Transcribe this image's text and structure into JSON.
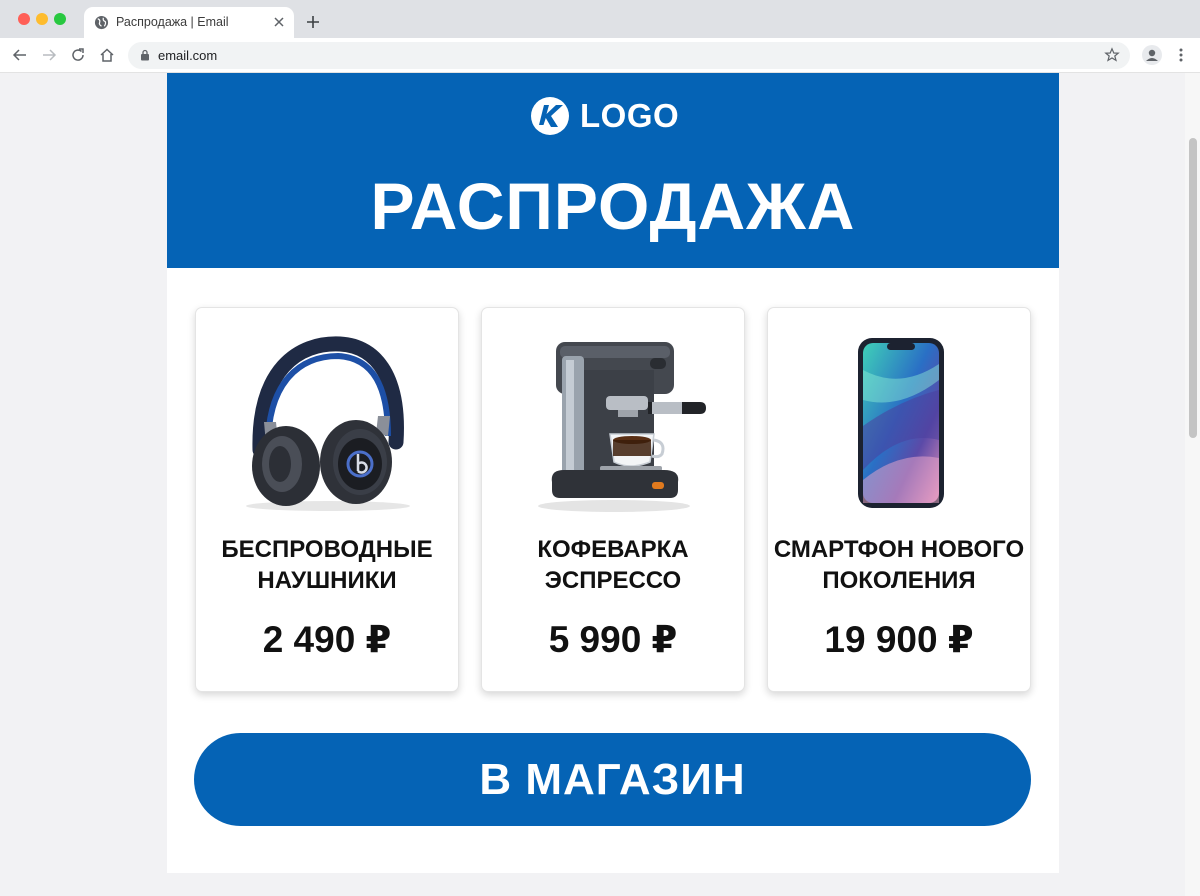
{
  "browser": {
    "tab_title": "Распродажа | Email",
    "url": "email.com"
  },
  "icons": {
    "tab": "globe-icon",
    "close": "close-icon",
    "new_tab": "plus-icon",
    "back": "arrow-left-icon",
    "forward": "arrow-right-icon",
    "reload": "reload-icon",
    "home": "home-icon",
    "lock": "lock-icon",
    "bookmark": "star-icon",
    "profile": "profile-icon",
    "menu": "more-vertical-icon"
  },
  "email": {
    "logo_text": "LOGO",
    "title": "РАСПРОДАЖА",
    "products": [
      {
        "name": "БЕСПРОВОДНЫЕ НАУШНИКИ",
        "price": "2 490 ₽",
        "image": "headphones"
      },
      {
        "name": "КОФЕВАРКА ЭСПРЕССО",
        "price": "5 990 ₽",
        "image": "espresso-machine"
      },
      {
        "name": "СМАРТФОН НОВОГО ПОКОЛЕНИЯ",
        "price": "19 900 ₽",
        "image": "smartphone"
      }
    ],
    "cta_label": "В МАГАЗИН"
  },
  "colors": {
    "brand_blue": "#0563b5",
    "page_background": "#f2f2f4",
    "text": "#111111"
  }
}
